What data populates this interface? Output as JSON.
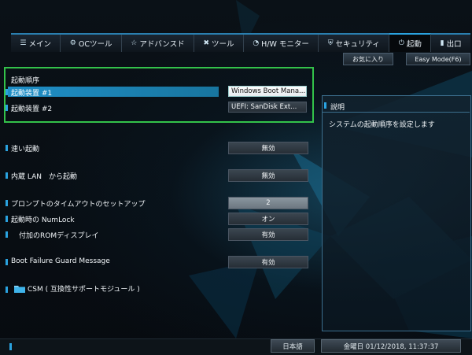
{
  "tabs": [
    {
      "icon": "☰",
      "label": "メイン"
    },
    {
      "icon": "⚙",
      "label": "OCツール"
    },
    {
      "icon": "☆",
      "label": "アドバンスド"
    },
    {
      "icon": "✖",
      "label": "ツール"
    },
    {
      "icon": "◔",
      "label": "H/W モニター"
    },
    {
      "icon": "⛨",
      "label": "セキュリティ"
    },
    {
      "icon": "⏻",
      "label": "起動"
    },
    {
      "icon": "▮",
      "label": "出口"
    }
  ],
  "top_buttons": {
    "favorites": "お気に入り",
    "easy_mode": "Easy Mode(F6)"
  },
  "boot_order": {
    "heading": "起動順序",
    "device1_label": "起動装置 #1",
    "device1_value": "Windows Boot Mana...",
    "device2_label": "起動装置 #2",
    "device2_value": "UEFI: SanDisk Ext..."
  },
  "settings": {
    "fast_boot_label": "速い起動",
    "fast_boot_value": "無効",
    "lan_boot_label": "内蔵 LAN　から起動",
    "lan_boot_value": "無効",
    "timeout_label": "プロンプトのタイムアウトのセットアップ",
    "timeout_value": "2",
    "numlock_label": "起動時の NumLock",
    "numlock_value": "オン",
    "rom_label": "付加のROMディスプレイ",
    "rom_value": "有効",
    "guard_label": "Boot Failure Guard Message",
    "guard_value": "有効",
    "csm_label": "CSM ( 互換性サポートモジュール )"
  },
  "description": {
    "title": "説明",
    "text": "システムの起動順序を設定します"
  },
  "bottom": {
    "language": "日本語",
    "datetime": "金曜日 01/12/2018, 11:37:37"
  },
  "colors": {
    "accent": "#2aa3e0",
    "highlight": "#1f8fc7",
    "box": "#33c24a"
  }
}
